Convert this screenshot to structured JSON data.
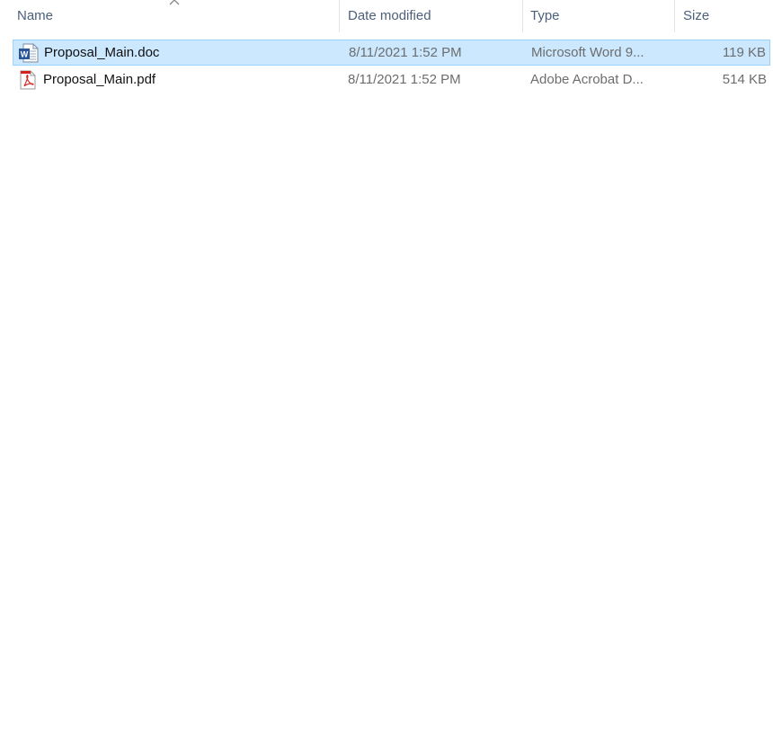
{
  "columns": {
    "name": "Name",
    "date": "Date modified",
    "type": "Type",
    "size": "Size"
  },
  "files": [
    {
      "name": "Proposal_Main.doc",
      "date": "8/11/2021 1:52 PM",
      "type": "Microsoft Word 9...",
      "size": "119 KB",
      "icon": "word-document-icon",
      "selected": true
    },
    {
      "name": "Proposal_Main.pdf",
      "date": "8/11/2021 1:52 PM",
      "type": "Adobe Acrobat D...",
      "size": "514 KB",
      "icon": "pdf-document-icon",
      "selected": false
    }
  ],
  "colors": {
    "selection_bg": "#cce8ff",
    "selection_border": "#99d1ff",
    "header_text": "#4c607a",
    "word_blue": "#2b579a",
    "pdf_red": "#d4231c"
  }
}
